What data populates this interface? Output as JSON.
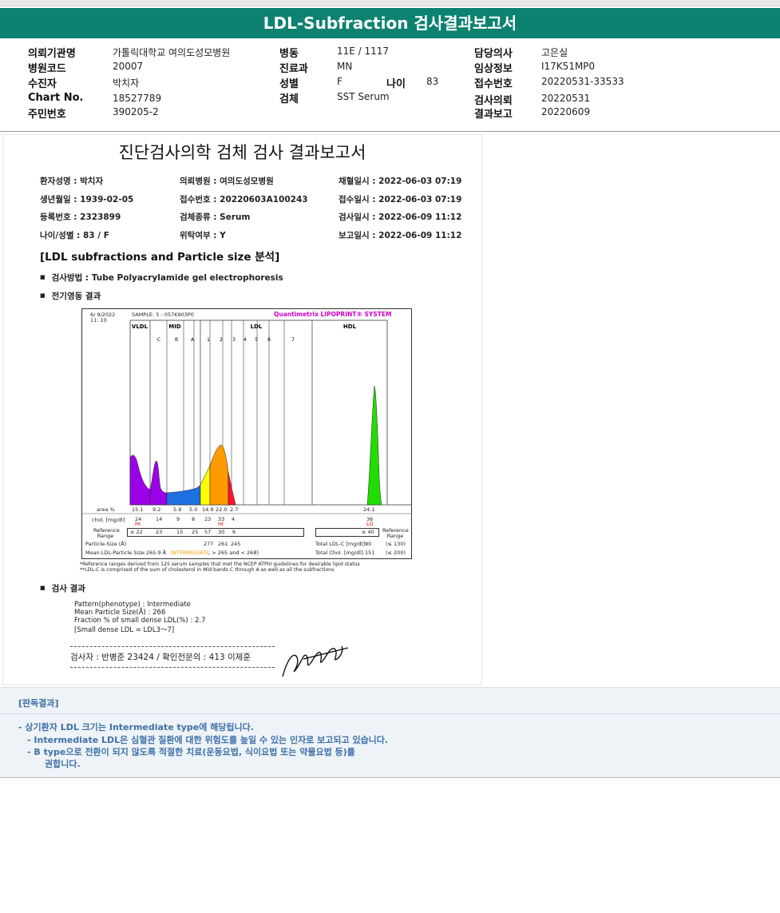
{
  "title": "LDL-Subfraction 검사결과보고서",
  "info": {
    "col1": [
      {
        "label": "의뢰기관명",
        "value": "가톨릭대학교 여의도성모병원"
      },
      {
        "label": "병원코드",
        "value": "20007"
      },
      {
        "label": "수진자",
        "value": "박치자"
      },
      {
        "label": "Chart No.",
        "value": "18527789"
      },
      {
        "label": "주민번호",
        "value": "390205-2"
      }
    ],
    "col2": [
      {
        "label": "병동",
        "value": "11E / 1117"
      },
      {
        "label": "진료과",
        "value": "MN"
      },
      {
        "label": "성별",
        "value": "F"
      },
      {
        "label": "검체",
        "value": "SST Serum"
      }
    ],
    "age": {
      "label": "나이",
      "value": "83"
    },
    "col3": [
      {
        "label": "담당의사",
        "value": "고은실"
      },
      {
        "label": "임상정보",
        "value": "I17K51MP0"
      },
      {
        "label": "접수번호",
        "value": "20220531-33533"
      },
      {
        "label": "검사의뢰",
        "value": "20220531"
      },
      {
        "label": "결과보고",
        "value": "20220609"
      }
    ]
  },
  "report": {
    "title": "진단검사의학 검체 검사 결과보고서",
    "rows": [
      [
        "환자성명 : 박치자",
        "의뢰병원 : 여의도성모병원",
        "채혈일시 : 2022-06-03 07:19"
      ],
      [
        "생년월일 : 1939-02-05",
        "접수번호 : 20220603A100243",
        "접수일시 : 2022-06-03 07:19"
      ],
      [
        "등록번호 : 2323899",
        "검체종류 : Serum",
        "검사일시 : 2022-06-09 11:12"
      ],
      [
        "나이/성별 : 83 / F",
        "위탁여부 : Y",
        "보고일시 : 2022-06-09 11:12"
      ]
    ],
    "section": "[LDL subfractions and Particle size 분석]",
    "method": "검사방법 : Tube Polyacrylamide gel electrophoresis",
    "electro": "전기영동 결과",
    "result_head": "검사 결과",
    "results": [
      "Pattern(phenotype) : Intermediate",
      "Mean Particle Size(Å) : 266",
      "Fraction % of small dense LDL(%) : 2.7",
      "[Small dense LDL = LDL3～7]"
    ],
    "footnotes": [
      "*Reference ranges derived from 125 serum samples that met the NCEP ATPIII guidelines for desirable lipid status",
      "**LDL-C is comprised of the sum of cholesterol in Mid bands C through A as well as all the subfractions"
    ],
    "signature": "검사자 : 반병준 23424 / 확인전문의 : 413 이제훈"
  },
  "chart_data": {
    "type": "area",
    "title": "Quantimetrix LIPOPRINT® SYSTEM",
    "date": "6/ 9/2022",
    "time": "11: 10",
    "sample": "SAMPLE:   5 - 057K903P0",
    "groups": [
      "VLDL",
      "MID",
      "LDL",
      "HDL"
    ],
    "bands": [
      "C",
      "B",
      "A",
      "1",
      "2",
      "3",
      "4",
      "5",
      "6",
      "7"
    ],
    "row_labels": {
      "area": "area %",
      "chol": "chol. [mg/dl]",
      "ref": "Reference Range",
      "size": "Particle-Size (Å)",
      "mean": "Mean LDL-Particle Size:"
    },
    "area_pct": {
      "VLDL": "15.1",
      "C": "9.2",
      "B": "5.9",
      "A": "5.0",
      "1": "14.9",
      "2": "22.0",
      "3": "2.7",
      "HDL": "24.1"
    },
    "chol": {
      "VLDL": "24",
      "C": "14",
      "B": "9",
      "A": "8",
      "1": "23",
      "2": "33",
      "3": "4",
      "HDL": "36"
    },
    "flags": {
      "VLDL": "HI",
      "2": "HI",
      "HDL": "LO"
    },
    "ref_range": {
      "VLDL": "≤ 22",
      "C": "23",
      "B": "15",
      "A": "25",
      "1": "57",
      "2": "30",
      "3": "6",
      "HDL": "≥ 40"
    },
    "particle_size": {
      "1": "277",
      "2": "261",
      "3": "245"
    },
    "mean_size": "265.9 Å",
    "mean_class": "INTERMEDIATE",
    "mean_range": "; > 265 and < 268)",
    "total_ldl": {
      "label": "Total LDL-C [mg/dl]:",
      "value": "90",
      "ref": "(≤ 130)"
    },
    "total_chol": {
      "label": "Total Chol. [mg/dl]:",
      "value": "151",
      "ref": "(≤ 200)"
    },
    "ref_label": "Reference Range",
    "colors": {
      "vldl": "#9b00e6",
      "mid": "#1e6fe0",
      "ldl1": "#ffff00",
      "ldl2": "#ff9a00",
      "ldl3": "#ff1030",
      "hdl": "#22dd00"
    }
  },
  "judgment": {
    "head": "[판독결과]",
    "lines": [
      "- 상기환자 LDL 크기는 Intermediate type에 해당됩니다.",
      "- Intermediate LDL은 심혈관 질환에 대한 위험도를 높일 수 있는 인자로 보고되고 있습니다.",
      "- B type으로 전환이 되지 않도록 적절한 치료(운동요법, 식이요법 또는 약물요법 등)를",
      "권합니다."
    ]
  }
}
